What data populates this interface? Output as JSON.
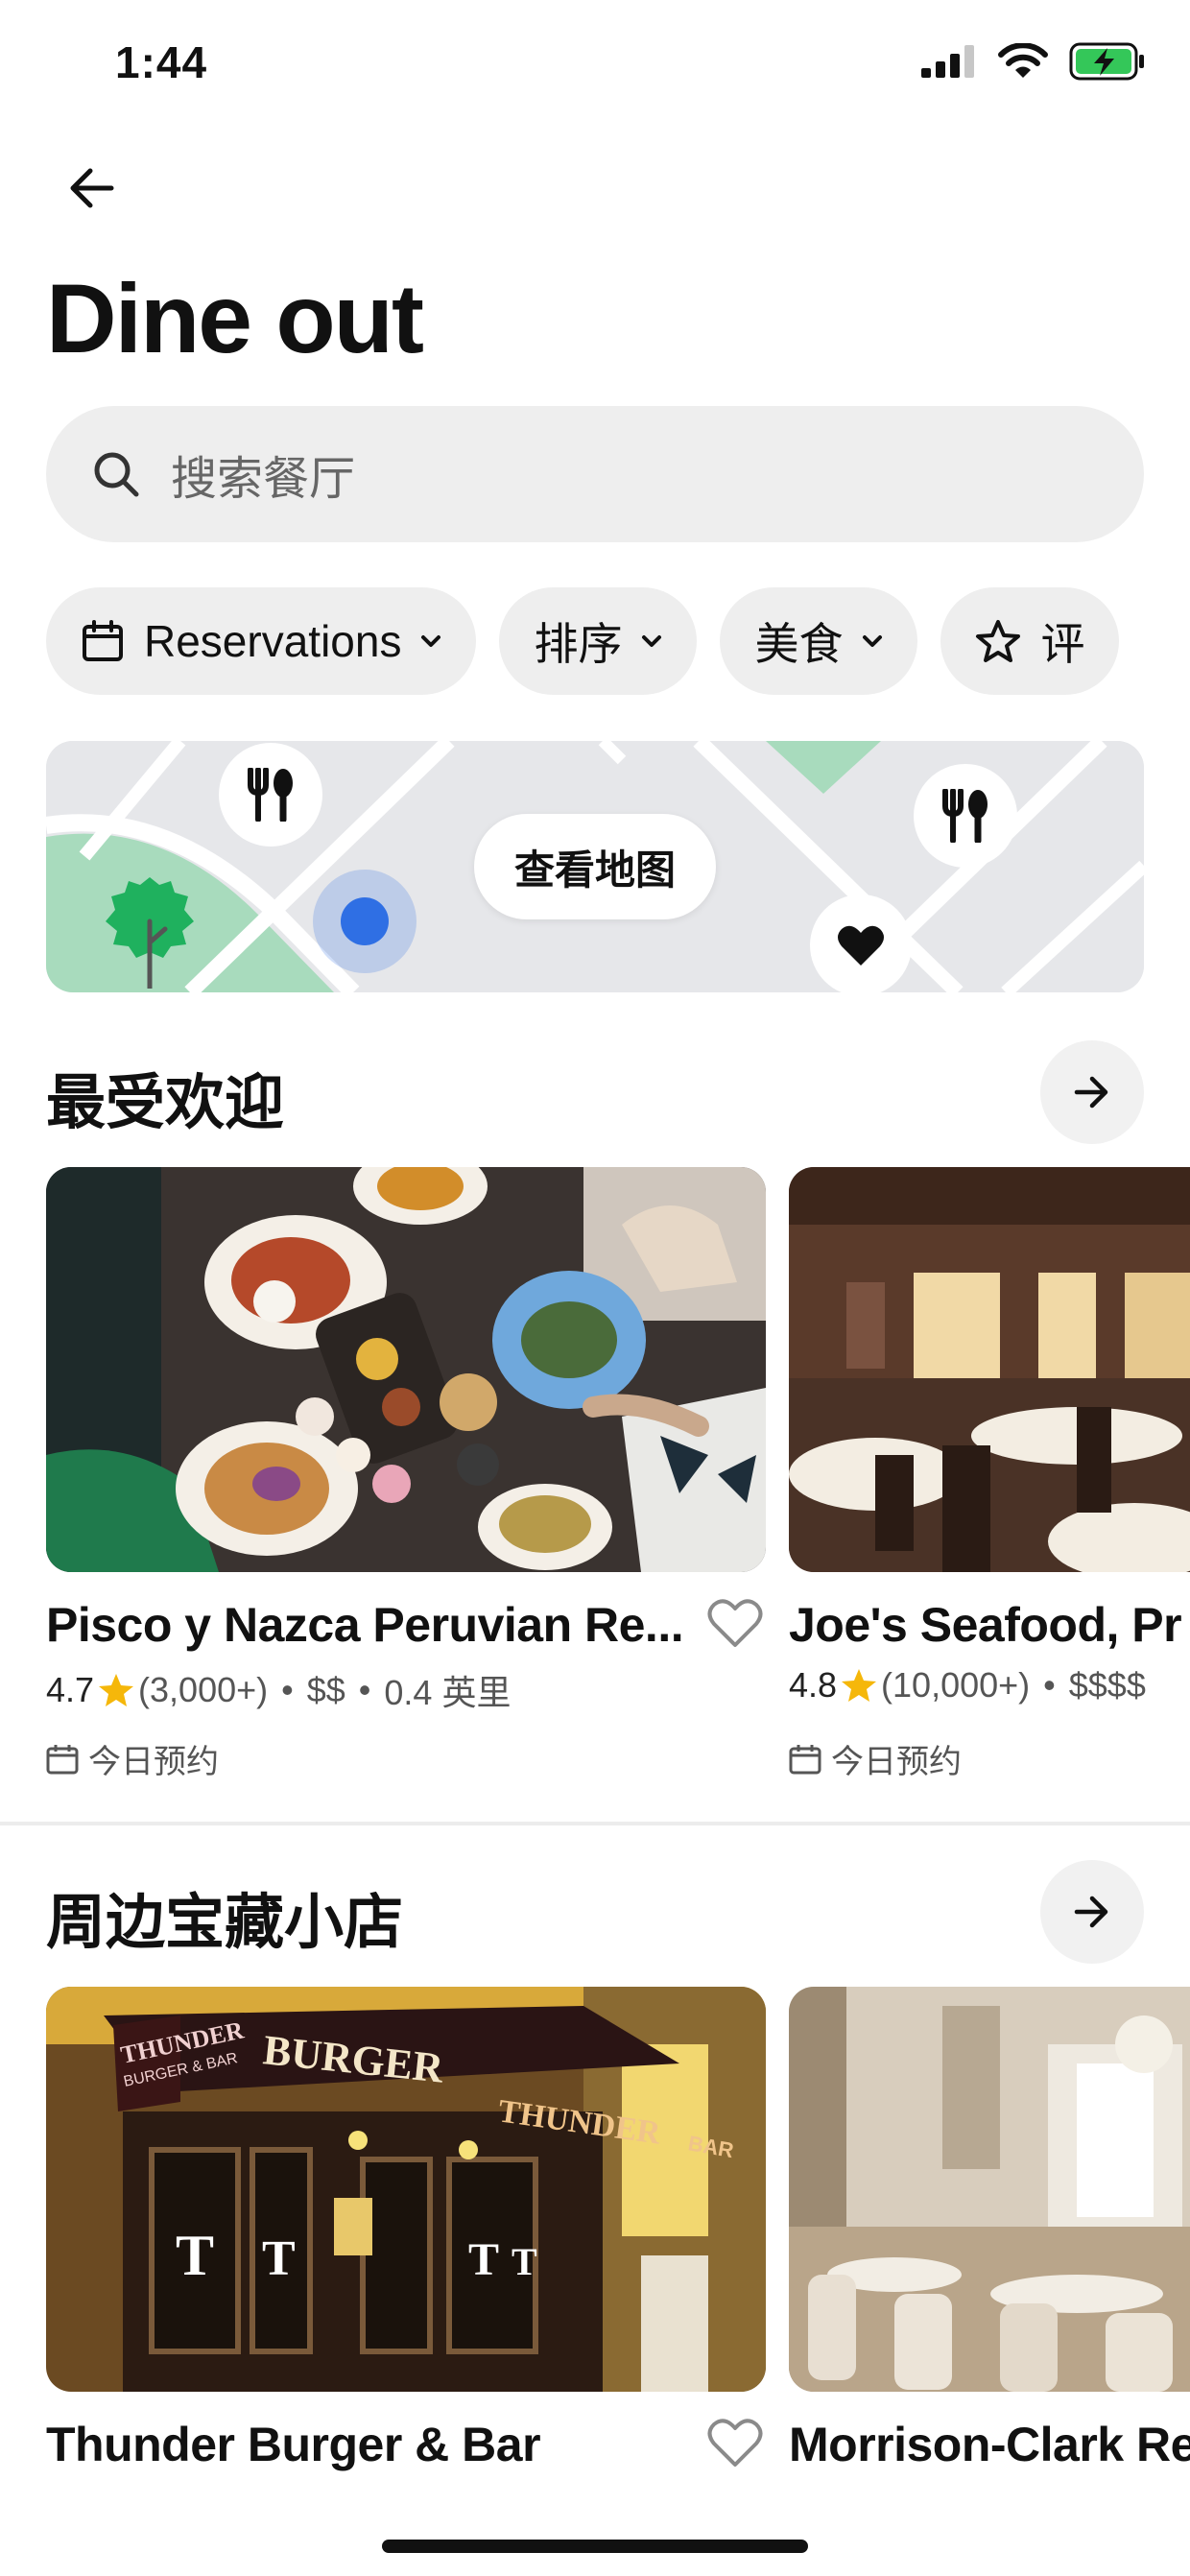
{
  "status_bar": {
    "time": "1:44"
  },
  "header": {
    "title": "Dine out"
  },
  "search": {
    "placeholder": "搜索餐厅"
  },
  "filters": [
    {
      "label": "Reservations",
      "icon": "calendar-icon"
    },
    {
      "label": "排序"
    },
    {
      "label": "美食"
    },
    {
      "label": "评",
      "icon": "star-icon"
    }
  ],
  "map": {
    "button_label": "查看地图"
  },
  "sections": [
    {
      "title": "最受欢迎",
      "cards": [
        {
          "name": "Pisco y Nazca Peruvian Re...",
          "rating": "4.7",
          "reviews": "(3,000+)",
          "price": "$$",
          "distance": "0.4 英里",
          "reservation": "今日预约"
        },
        {
          "name": "Joe's Seafood, Pr",
          "rating": "4.8",
          "reviews": "(10,000+)",
          "price": "$$$$",
          "reservation": "今日预约"
        }
      ]
    },
    {
      "title": "周边宝藏小店",
      "cards": [
        {
          "name": "Thunder Burger & Bar",
          "sign_main": "BURGER",
          "sign_sub": "THUNDER",
          "sign_logo_top": "THUNDER",
          "sign_logo_bottom": "BURGER & BAR",
          "sign_bar": "BAR",
          "window_glyph": "T"
        },
        {
          "name": "Morrison-Clark Re"
        }
      ]
    }
  ],
  "colors": {
    "star": "#f5b70a",
    "map_green": "#a8dbbd",
    "tree_green": "#1fb15e",
    "location_blue": "#2f6fe4",
    "chip_bg": "#eeeeee",
    "battery_green": "#34c759"
  }
}
